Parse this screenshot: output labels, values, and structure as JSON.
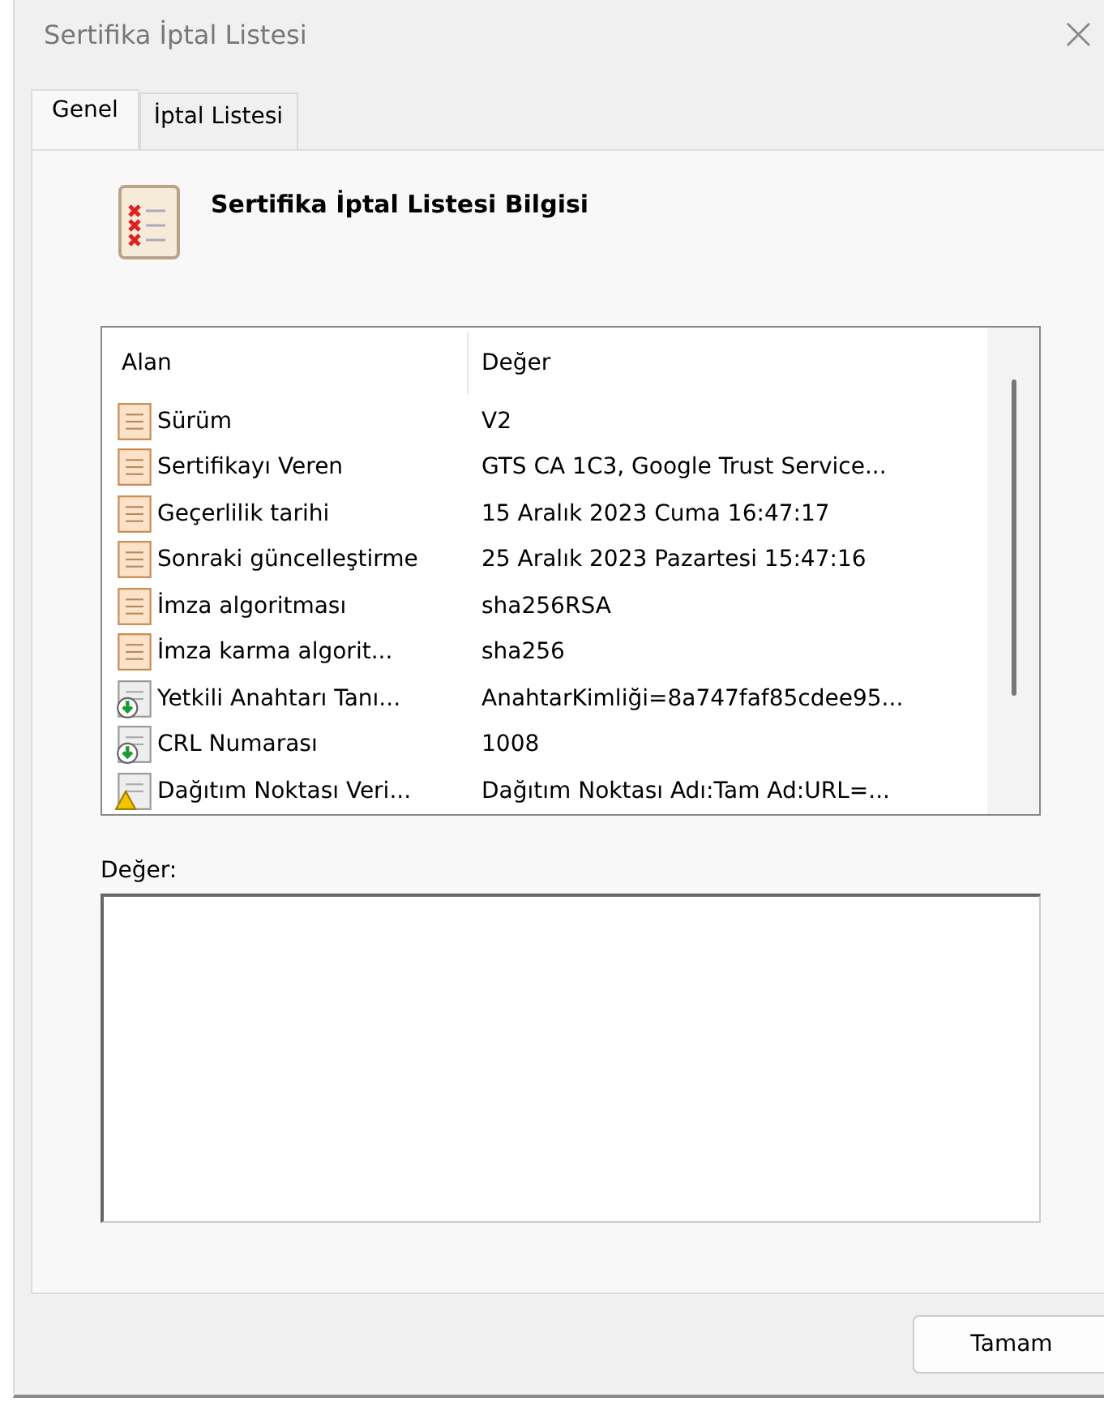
{
  "window": {
    "title": "Sertifika İptal Listesi",
    "close": "×"
  },
  "tabs": [
    {
      "label": "Genel",
      "selected": true
    },
    {
      "label": "İptal Listesi",
      "selected": false
    }
  ],
  "heading": "Sertifika İptal Listesi Bilgisi",
  "table": {
    "columns": [
      "Alan",
      "Değer"
    ],
    "rows": [
      {
        "kind": "field",
        "field": "Sürüm",
        "value": "V2"
      },
      {
        "kind": "field",
        "field": "Sertifikayı Veren",
        "value": "GTS CA 1C3, Google Trust Service..."
      },
      {
        "kind": "field",
        "field": "Geçerlilik tarihi",
        "value": "15 Aralık 2023 Cuma 16:47:17"
      },
      {
        "kind": "field",
        "field": "Sonraki güncelleştirme",
        "value": "25 Aralık 2023 Pazartesi 15:47:16"
      },
      {
        "kind": "field",
        "field": "İmza algoritması",
        "value": "sha256RSA"
      },
      {
        "kind": "field",
        "field": "İmza karma algorit...",
        "value": "sha256"
      },
      {
        "kind": "extension",
        "field": "Yetkili Anahtarı Tanı...",
        "value": "AnahtarKimliği=8a747faf85cdee95..."
      },
      {
        "kind": "extension",
        "field": "CRL Numarası",
        "value": "1008"
      },
      {
        "kind": "critical",
        "field": "Dağıtım Noktası Veri...",
        "value": "Dağıtım Noktası Adı:Tam Ad:URL=..."
      }
    ]
  },
  "value_label": "Değer:",
  "buttons": [
    "Tamam"
  ]
}
